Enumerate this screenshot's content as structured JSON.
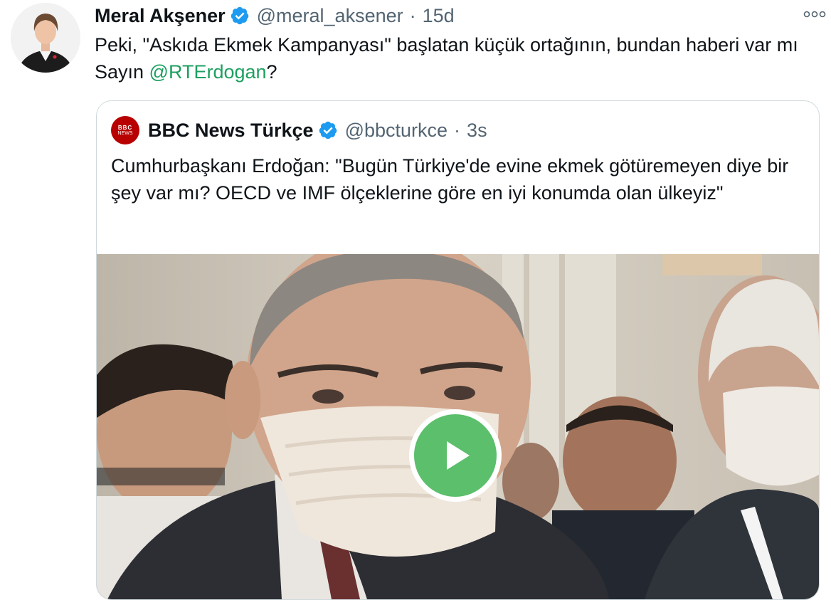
{
  "tweet": {
    "author_name": "Meral Akşener",
    "author_handle": "@meral_aksener",
    "separator": "·",
    "time": "15d",
    "text_before": "Peki, \"Askıda Ekmek Kampanyası\" başlatan küçük ortağının, bundan haberi var mı Sayın ",
    "mention": "@RTErdogan",
    "text_after": "?",
    "verified_icon": "verified-badge-icon",
    "more_icon": "more-options-icon"
  },
  "quote": {
    "logo_line1": "BBC",
    "logo_line2": "NEWS",
    "author_name": "BBC News Türkçe",
    "author_handle": "@bbcturkce",
    "separator": "·",
    "time": "3s",
    "text": "Cumhurbaşkanı Erdoğan: \"Bugün Türkiye'de evine ekmek götüremeyen diye bir şey var mı? OECD ve IMF ölçeklerine göre en iyi konumda olan ülkeyiz\"",
    "media_icon": "play-button-icon"
  },
  "colors": {
    "mention": "#1da060",
    "verified": "#1d9bf0",
    "play": "#5bbf6b",
    "bbc_red": "#b80000",
    "border": "#cfd9de",
    "secondary_text": "#536471"
  }
}
